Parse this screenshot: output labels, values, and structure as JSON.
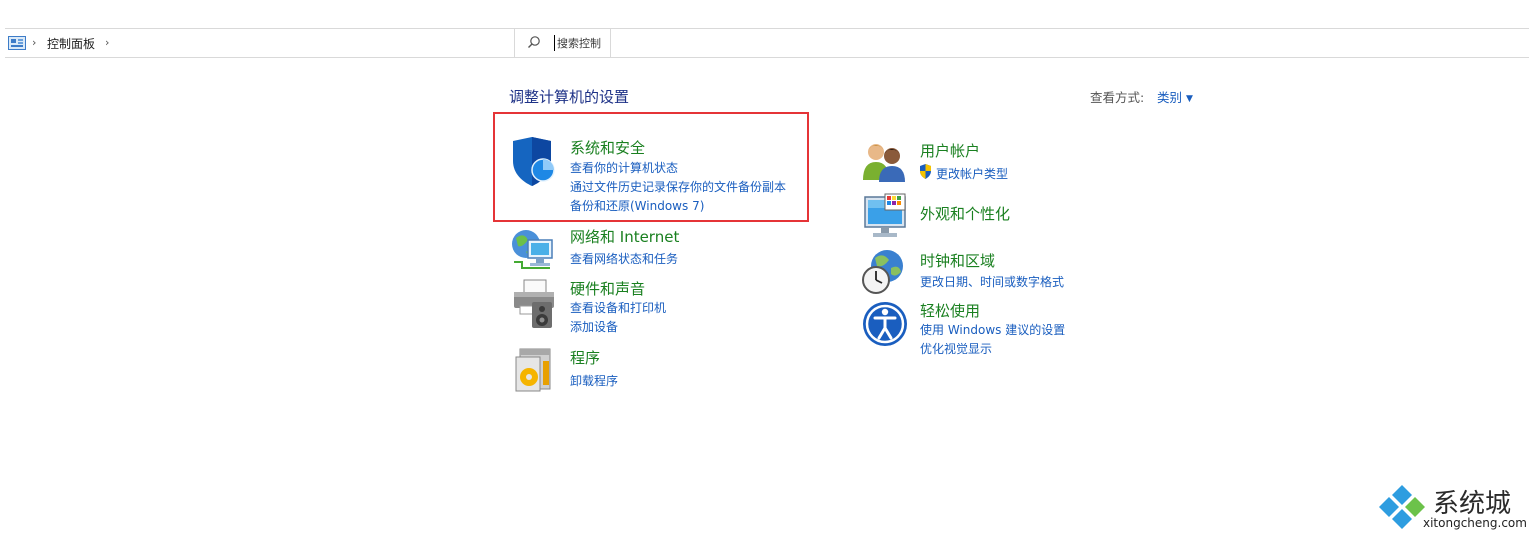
{
  "breadcrumb": {
    "label": "控制面板"
  },
  "search": {
    "placeholder": "搜索控制"
  },
  "header": {
    "title": "调整计算机的设置",
    "view_by_label": "查看方式:",
    "view_by_value": "类别"
  },
  "categories": {
    "system_security": {
      "title": "系统和安全",
      "links": [
        "查看你的计算机状态",
        "通过文件历史记录保存你的文件备份副本",
        "备份和还原(Windows 7)"
      ]
    },
    "network": {
      "title": "网络和 Internet",
      "links": [
        "查看网络状态和任务"
      ]
    },
    "hardware": {
      "title": "硬件和声音",
      "links": [
        "查看设备和打印机",
        "添加设备"
      ]
    },
    "programs": {
      "title": "程序",
      "links": [
        "卸载程序"
      ]
    },
    "user_accounts": {
      "title": "用户帐户",
      "links": [
        "更改帐户类型"
      ]
    },
    "appearance": {
      "title": "外观和个性化"
    },
    "clock_region": {
      "title": "时钟和区域",
      "links": [
        "更改日期、时间或数字格式"
      ]
    },
    "ease_of_access": {
      "title": "轻松使用",
      "links": [
        "使用 Windows 建议的设置",
        "优化视觉显示"
      ]
    }
  },
  "watermark": {
    "name": "系统城",
    "url": "xitongcheng.com"
  },
  "colors": {
    "category_title": "#1a8020",
    "link": "#1a5ebf",
    "highlight_box": "#e53437",
    "page_title": "#1e3287"
  }
}
